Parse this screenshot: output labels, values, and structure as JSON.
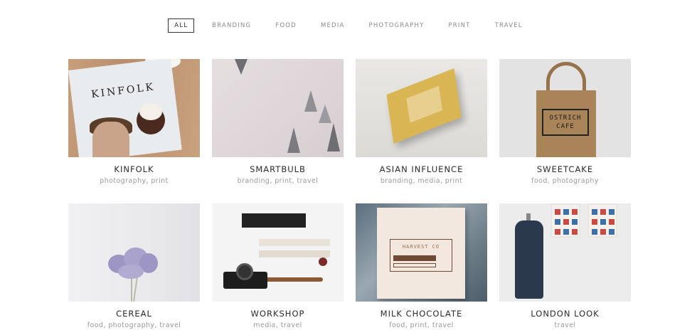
{
  "filters": [
    "ALL",
    "BRANDING",
    "FOOD",
    "MEDIA",
    "PHOTOGRAPHY",
    "PRINT",
    "TRAVEL"
  ],
  "active_filter": "ALL",
  "projects": [
    {
      "title": "KINFOLK",
      "tags": "photography, print"
    },
    {
      "title": "SMARTBULB",
      "tags": "branding, print, travel"
    },
    {
      "title": "ASIAN INFLUENCE",
      "tags": "branding, media, print"
    },
    {
      "title": "SWEETCAKE",
      "tags": "food, photography"
    },
    {
      "title": "CEREAL",
      "tags": "food, photography, travel"
    },
    {
      "title": "WORKSHOP",
      "tags": "media, travel"
    },
    {
      "title": "MILK CHOCOLATE",
      "tags": "food, print, travel"
    },
    {
      "title": "LONDON LOOK",
      "tags": "travel"
    }
  ],
  "artwork": {
    "kinfolk_masthead": "KINFOLK",
    "sweetcake_label_line1": "OSTRICH",
    "sweetcake_label_line2": "CAFE",
    "milk_label": "HARVEST CO"
  }
}
